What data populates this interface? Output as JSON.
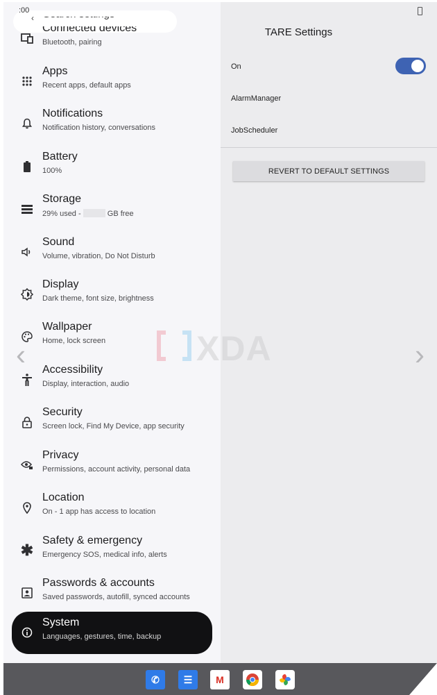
{
  "status": {
    "time": ":00"
  },
  "search": {
    "label": "Search settings"
  },
  "settings_list": [
    {
      "title": "Connected devices",
      "subtitle": "Bluetooth, pairing",
      "icon": "devices-icon"
    },
    {
      "title": "Apps",
      "subtitle": "Recent apps, default apps",
      "icon": "apps-grid-icon"
    },
    {
      "title": "Notifications",
      "subtitle": "Notification history, conversations",
      "icon": "bell-icon"
    },
    {
      "title": "Battery",
      "subtitle": "100%",
      "icon": "battery-icon"
    },
    {
      "title": "Storage",
      "subtitle_prefix": "29% used - ",
      "subtitle_suffix": "GB free",
      "icon": "storage-icon"
    },
    {
      "title": "Sound",
      "subtitle": "Volume, vibration, Do Not Disturb",
      "icon": "speaker-icon"
    },
    {
      "title": "Display",
      "subtitle": "Dark theme, font size, brightness",
      "icon": "brightness-icon"
    },
    {
      "title": "Wallpaper",
      "subtitle": "Home, lock screen",
      "icon": "palette-icon"
    },
    {
      "title": "Accessibility",
      "subtitle": "Display, interaction, audio",
      "icon": "accessibility-icon"
    },
    {
      "title": "Security",
      "subtitle": "Screen lock, Find My Device, app security",
      "icon": "lock-icon"
    },
    {
      "title": "Privacy",
      "subtitle": "Permissions, account activity, personal data",
      "icon": "eye-lock-icon"
    },
    {
      "title": "Location",
      "subtitle": "On - 1 app has access to location",
      "icon": "location-pin-icon"
    },
    {
      "title": "Safety & emergency",
      "subtitle": "Emergency SOS, medical info, alerts",
      "icon": "asterisk-icon"
    },
    {
      "title": "Passwords & accounts",
      "subtitle": "Saved passwords, autofill, synced accounts",
      "icon": "account-box-icon"
    },
    {
      "title": "System",
      "subtitle": "Languages, gestures, time, backup",
      "icon": "info-icon",
      "selected": true
    }
  ],
  "tare": {
    "title": "TARE Settings",
    "on_label": "On",
    "toggle_on": true,
    "alarm_manager": "AlarmManager",
    "job_scheduler": "JobScheduler",
    "revert_button": "REVERT TO DEFAULT SETTINGS"
  },
  "watermark": {
    "text": "XDA"
  },
  "dock_apps": [
    "phone-app-icon",
    "messages-app-icon",
    "gmail-app-icon",
    "chrome-app-icon",
    "photos-app-icon"
  ],
  "colors": {
    "accent": "#3e63b3",
    "selected_bg": "#111113",
    "dock_bg": "#58585c"
  }
}
